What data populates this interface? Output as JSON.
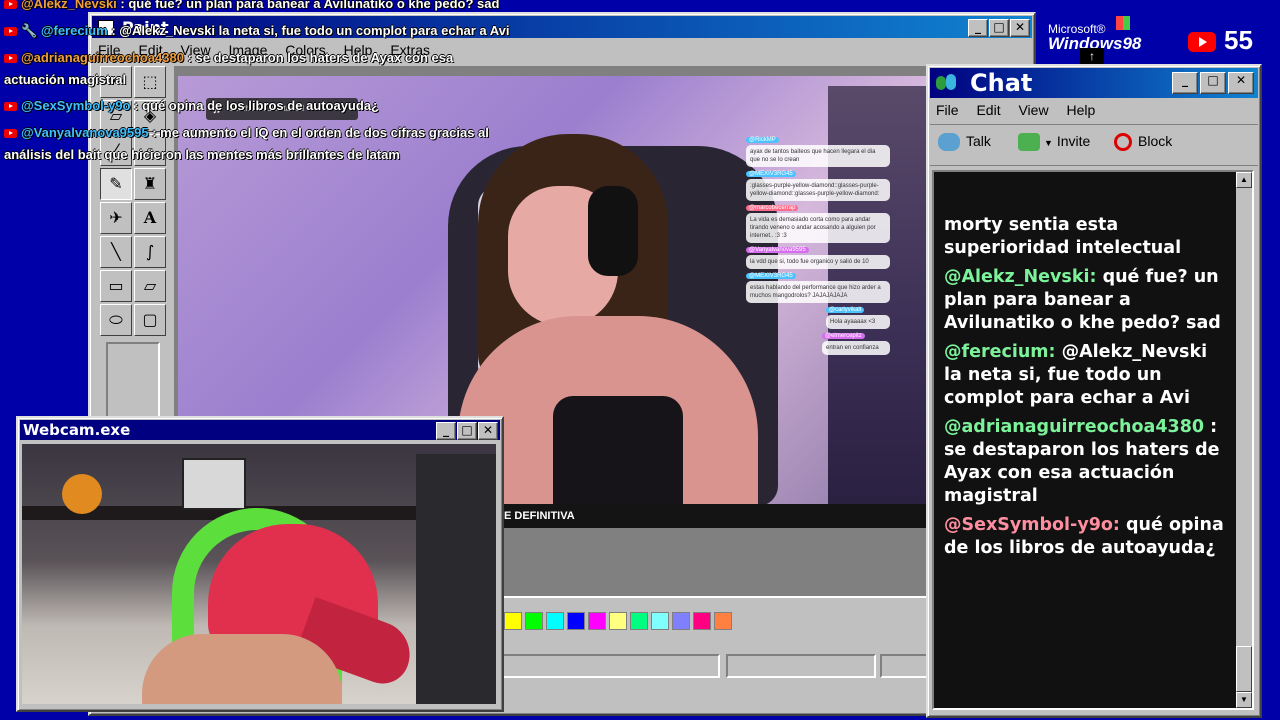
{
  "overlay_chat": [
    {
      "user": "@Alekz_Nevski",
      "text": ": qué fue? un plan para banear a Avilunatiko o khe pedo? sad"
    },
    {
      "user": "@ferecium",
      "text": ": @Alekz_Nevski la neta si, fue todo un complot para echar a Avi"
    },
    {
      "user": "@adrianaguirreochoa4380",
      "text": ": se destaparon los haters de Ayax con esa",
      "cont": "actuación magistral"
    },
    {
      "user": "@SexSymbol-y9o",
      "text": ": qué opina de los libros de autoayuda¿"
    },
    {
      "user": "@Vanyalvanova9595",
      "text": ": me aumento el IQ en el orden de dos cifras gracias al",
      "cont": "análisis del bait que hicieron las mentes más brillantes de latam"
    }
  ],
  "brand": {
    "microsoft": "Microsoft®",
    "windows": "Windows98"
  },
  "youtube": {
    "count": "55"
  },
  "paint": {
    "title": "Paint",
    "menu": [
      "File",
      "Edit",
      "View",
      "Image",
      "Colors",
      "Help",
      "Extras"
    ],
    "music_label": "Get the music started",
    "banner_text": "E DEFINITIVA",
    "palette": [
      "#ffff00",
      "#00ff00",
      "#00ffff",
      "#0000ff",
      "#ff00ff",
      "#ffff80",
      "#00ff80",
      "#80ffff",
      "#8080ff",
      "#ff0080",
      "#ff8040"
    ]
  },
  "stream_chat_bubbles": [
    {
      "user": "@RickMP",
      "text": "ayax de tantos baiteos que hacen llegara el dia que no se lo crean"
    },
    {
      "user": "@MEXIV3RG45",
      "text": ":glasses-purple-yellow-diamond::glasses-purple-yellow-diamond::glasses-purple-yellow-diamond:"
    },
    {
      "user": "@marcobecerrap",
      "text": "La vida es demasiado corta como para andar tirando veneno o andar acosando a alguien por internet.. :3 :3"
    },
    {
      "user": "@Vanyalvanova9595",
      "text": "la vdd que si, todo fue organico y salió de 10"
    },
    {
      "user": "@MEXIV3RG45",
      "text": "estas hablando del performance que hizo arder a muchos mangodrolos? JAJAJAJAJA"
    },
    {
      "user": "@carlyvikalt",
      "text": "Hola ayaaaax <3"
    },
    {
      "user": "@elmercepitz",
      "text": "entran en confianza"
    }
  ],
  "webcam": {
    "title": "Webcam.exe"
  },
  "chat": {
    "title": "Chat",
    "menu": [
      "File",
      "Edit",
      "View",
      "Help"
    ],
    "talk": "Talk",
    "invite": "Invite",
    "block": "Block",
    "first_line": "morty sentia esta superioridad intelectual",
    "messages": [
      {
        "user": "@Alekz_Nevski:",
        "text": "qué fue? un plan para banear a Avilunatiko o khe pedo? sad"
      },
      {
        "user": "@ferecium:",
        "text": "@Alekz_Nevski la neta si, fue todo un complot para echar a Avi"
      },
      {
        "user": "@adrianaguirreochoa4380",
        "text": ": se destaparon los haters de Ayax con esa actuación magistral"
      },
      {
        "user": "@SexSymbol-y9o:",
        "text": "qué opina de los libros de autoayuda¿"
      }
    ]
  },
  "colors": {
    "desktop": "#0000a8",
    "title_start": "#000080",
    "title_end": "#1084d0",
    "chat_bg": "#111111",
    "user_green": "#7cf29a",
    "user_pink": "#ff8fa0"
  }
}
